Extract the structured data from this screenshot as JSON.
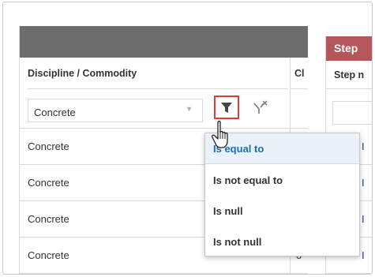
{
  "grid": {
    "column_header": "Discipline / Commodity",
    "next_column_header_partial": "Cl",
    "filter_value": "Concrete",
    "rows": [
      "Concrete",
      "Concrete",
      "Concrete",
      "Concrete"
    ],
    "partial_cells": [
      "",
      "",
      "",
      "0"
    ]
  },
  "right_panel": {
    "band_title": "Step",
    "column_header_partial": "Step n",
    "row_markers": [
      "I",
      "I",
      "I",
      "I"
    ]
  },
  "filter_menu": {
    "items": [
      "Is equal to",
      "Is not equal to",
      "Is null",
      "Is not null"
    ],
    "selected_index": 0
  },
  "icons": {
    "filter": "funnel-icon",
    "clear_filter": "clear-filter-icon",
    "dropdown": "chevron-down-icon",
    "pointer": "hand-pointer-icon"
  },
  "colors": {
    "header_band": "#6d6d6d",
    "step_band": "#b5565a",
    "highlight_border": "#e53935",
    "selected_text": "#1a6fb5",
    "selected_bg": "#eaf1f8"
  }
}
